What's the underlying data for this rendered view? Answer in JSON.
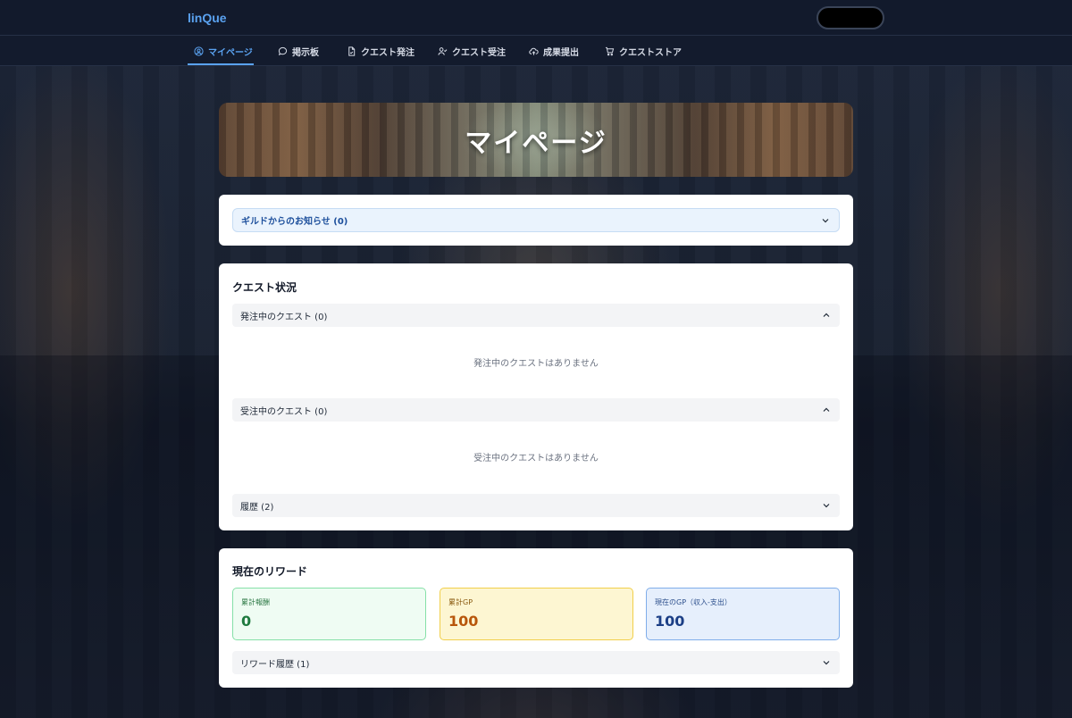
{
  "app": {
    "logo_text": "linQue"
  },
  "nav": {
    "items": [
      {
        "label": "マイページ",
        "icon": "user-circle-icon",
        "active": true
      },
      {
        "label": "掲示板",
        "icon": "chat-bubble-icon",
        "active": false
      },
      {
        "label": "クエスト発注",
        "icon": "document-icon",
        "active": false
      },
      {
        "label": "クエスト受注",
        "icon": "user-check-icon",
        "active": false
      },
      {
        "label": "成果提出",
        "icon": "upload-cloud-icon",
        "active": false
      },
      {
        "label": "クエストストア",
        "icon": "shopping-cart-icon",
        "active": false
      }
    ],
    "accent_color": "#5aa2f0"
  },
  "hero": {
    "title": "マイページ"
  },
  "notices": {
    "label": "ギルドからのお知らせ (0)"
  },
  "quest_status": {
    "title": "クエスト状況",
    "ordered": {
      "label": "発注中のクエスト (0)",
      "empty_text": "発注中のクエストはありません"
    },
    "accepted": {
      "label": "受注中のクエスト (0)",
      "empty_text": "受注中のクエストはありません"
    },
    "history": {
      "label": "履歴 (2)"
    }
  },
  "rewards": {
    "title": "現在のリワード",
    "total_reward": {
      "label": "累計報酬",
      "value": "0",
      "color": "#1f7a3f"
    },
    "total_gp": {
      "label": "累計GP",
      "value": "100",
      "color": "#b8560b"
    },
    "current_gp": {
      "label": "現在のGP（収入-支出）",
      "value": "100",
      "color": "#1c3f86"
    },
    "history": {
      "label": "リワード履歴 (1)"
    }
  }
}
